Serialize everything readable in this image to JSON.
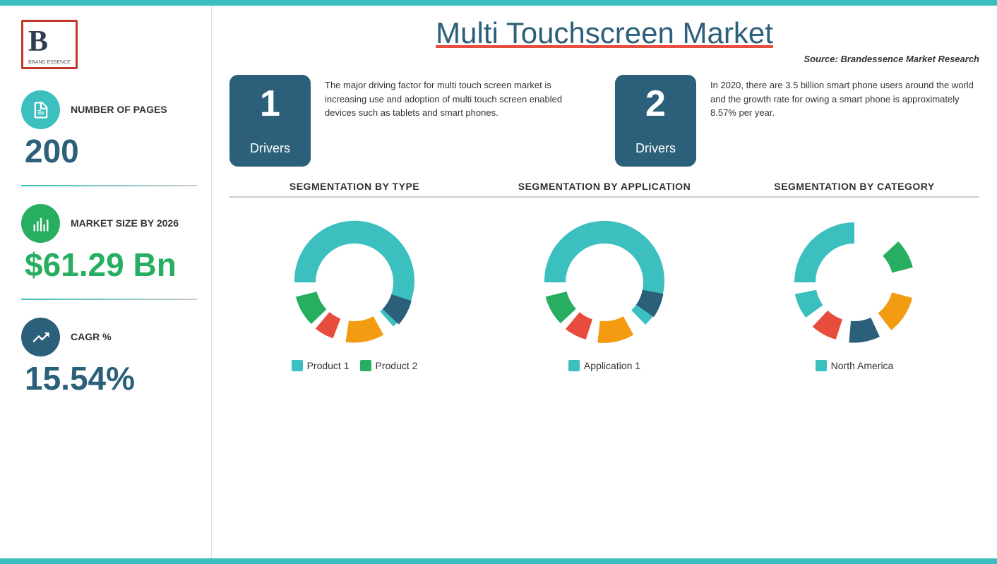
{
  "topBar": {
    "color": "#3bbfbf"
  },
  "sidebar": {
    "logo": {
      "letter": "B",
      "tagline": "BRAND ESSENCE"
    },
    "stats": [
      {
        "id": "pages",
        "iconType": "teal",
        "iconName": "document-icon",
        "label": "NUMBER of PAGES",
        "value": "200",
        "valueColor": "blue"
      },
      {
        "id": "marketsize",
        "iconType": "green",
        "iconName": "chart-icon",
        "label": "MARKET SIZE BY 2026",
        "value": "$61.29 Bn",
        "valueColor": "green"
      },
      {
        "id": "cagr",
        "iconType": "dark-blue",
        "iconName": "growth-icon",
        "label": "CAGR %",
        "value": "15.54%",
        "valueColor": "blue"
      }
    ]
  },
  "header": {
    "title": "Multi Touchscreen Market",
    "source": "Source: Brandessence Market Research"
  },
  "drivers": [
    {
      "number": "1",
      "label": "Drivers",
      "description": "The major driving factor for multi touch screen market is increasing use and adoption of multi touch screen enabled devices such as tablets and smart phones."
    },
    {
      "number": "2",
      "label": "Drivers",
      "description": "In 2020, there are 3.5 billion smart phone users around the world and the growth rate for owing a smart phone is approximately 8.57% per year."
    }
  ],
  "charts": [
    {
      "id": "by-type",
      "title": "SEGMENTATION  BY TYPE",
      "legend": [
        {
          "label": "Product  1",
          "color": "#3bbfbf"
        },
        {
          "label": "Product  2",
          "color": "#27ae60"
        }
      ],
      "segments": [
        {
          "color": "#3bbfbf",
          "percent": 55
        },
        {
          "color": "#2c5f7a",
          "percent": 12
        },
        {
          "color": "#f39c12",
          "percent": 14
        },
        {
          "color": "#e74c3c",
          "percent": 7
        },
        {
          "color": "#27ae60",
          "percent": 12
        }
      ]
    },
    {
      "id": "by-application",
      "title": "SEGMENTATION  BY APPLICATION",
      "legend": [
        {
          "label": "Application 1",
          "color": "#3bbfbf"
        }
      ],
      "segments": [
        {
          "color": "#3bbfbf",
          "percent": 53
        },
        {
          "color": "#2c5f7a",
          "percent": 14
        },
        {
          "color": "#f39c12",
          "percent": 13
        },
        {
          "color": "#e74c3c",
          "percent": 8
        },
        {
          "color": "#27ae60",
          "percent": 12
        }
      ]
    },
    {
      "id": "by-category",
      "title": "SEGMENTATION  BY CATEGORY",
      "legend": [
        {
          "label": "North America",
          "color": "#3bbfbf"
        }
      ],
      "segments": [
        {
          "color": "#3bbfbf",
          "percent": 38
        },
        {
          "color": "#27ae60",
          "percent": 16
        },
        {
          "color": "#2c5f7a",
          "percent": 12
        },
        {
          "color": "#f39c12",
          "percent": 14
        },
        {
          "color": "#e74c3c",
          "percent": 10
        },
        {
          "color": "#3bbfbf",
          "percent": 10
        }
      ]
    }
  ]
}
